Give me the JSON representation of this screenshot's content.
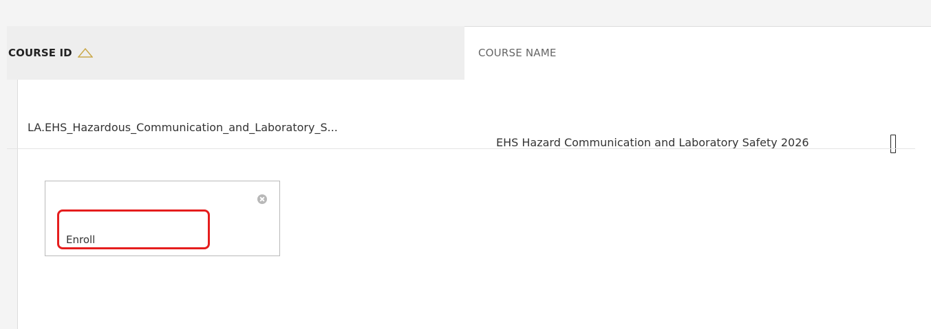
{
  "table": {
    "headers": {
      "course_id": "COURSE ID",
      "course_name": "COURSE NAME"
    },
    "sort": {
      "column": "course_id",
      "icon": "sort-triangle-icon"
    },
    "rows": [
      {
        "course_id": "LA.EHS_Hazardous_Communication_and_Laboratory_S...",
        "course_name": "EHS Hazard Communication and Laboratory Safety 2026"
      }
    ]
  },
  "popup": {
    "close_icon": "close-icon",
    "action_label": "Enroll"
  },
  "colors": {
    "highlight": "#e51d1d",
    "header_bg": "#eeeeee",
    "page_bg": "#f4f4f4"
  }
}
